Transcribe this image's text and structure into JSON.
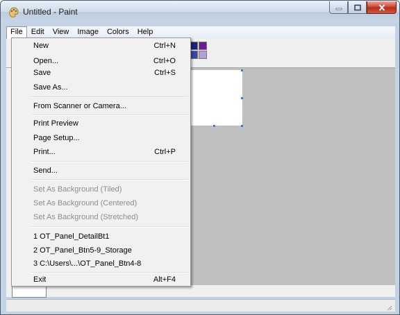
{
  "window": {
    "title": "Untitled - Paint"
  },
  "menubar": [
    "File",
    "Edit",
    "View",
    "Image",
    "Colors",
    "Help"
  ],
  "file_menu": {
    "items": [
      {
        "label": "New",
        "shortcut": "Ctrl+N",
        "enabled": true
      },
      {
        "label": "Open...",
        "shortcut": "Ctrl+O",
        "enabled": true
      },
      {
        "label": "Save",
        "shortcut": "Ctrl+S",
        "enabled": true
      },
      {
        "label": "Save As...",
        "shortcut": "",
        "enabled": true
      },
      {
        "label": "From Scanner or Camera...",
        "shortcut": "",
        "enabled": true
      },
      {
        "label": "Print Preview",
        "shortcut": "",
        "enabled": true
      },
      {
        "label": "Page Setup...",
        "shortcut": "",
        "enabled": true
      },
      {
        "label": "Print...",
        "shortcut": "Ctrl+P",
        "enabled": true
      },
      {
        "label": "Send...",
        "shortcut": "",
        "enabled": true
      },
      {
        "label": "Set As Background (Tiled)",
        "shortcut": "",
        "enabled": false
      },
      {
        "label": "Set As Background (Centered)",
        "shortcut": "",
        "enabled": false
      },
      {
        "label": "Set As Background (Stretched)",
        "shortcut": "",
        "enabled": false
      },
      {
        "label": "1 OT_Panel_DetailBt1",
        "shortcut": "",
        "enabled": true
      },
      {
        "label": "2 OT_Panel_Btn5-9_Storage",
        "shortcut": "",
        "enabled": true
      },
      {
        "label": "3 C:\\Users\\...\\OT_Panel_Btn4-8",
        "shortcut": "",
        "enabled": true
      },
      {
        "label": "Exit",
        "shortcut": "Alt+F4",
        "enabled": true
      }
    ]
  },
  "palette_colors": [
    "#1a237e",
    "#6a1b9a",
    "#3949ab",
    "#b39ddb"
  ],
  "colors": {
    "canvas_bg": "#c0c0c0",
    "menu_bg": "#f1f1f1",
    "disabled_text": "#8d8d8d"
  }
}
